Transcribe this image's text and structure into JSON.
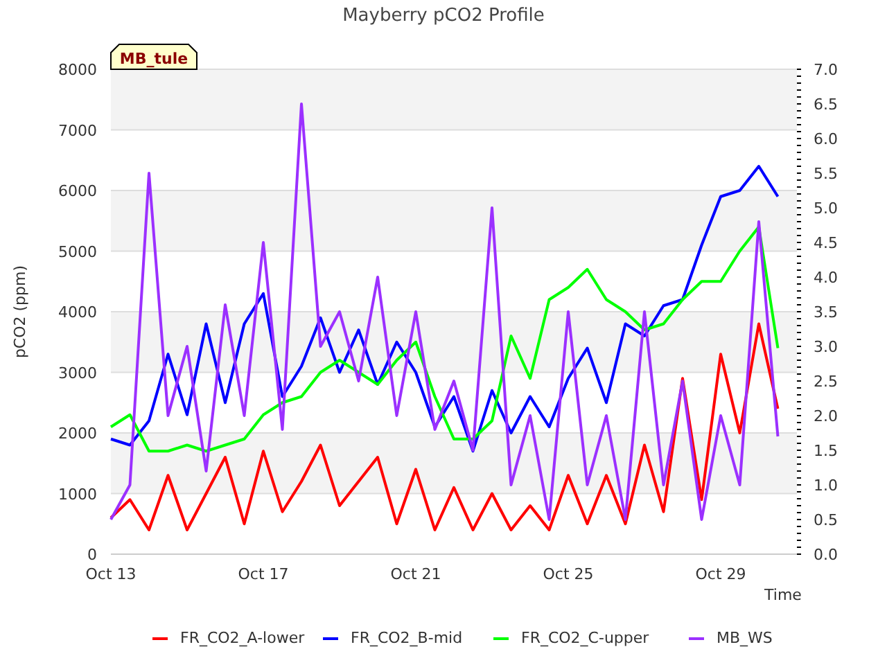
{
  "chart": {
    "site_label": "MB_tule",
    "chart_data": {
      "type": "line",
      "title": "Mayberry pCO2 Profile",
      "xlabel": "Time",
      "ylabel": "pCO2 (ppm)",
      "categories": [
        "Oct 13",
        null,
        null,
        null,
        null,
        null,
        null,
        null,
        "Oct 17",
        null,
        null,
        null,
        null,
        null,
        null,
        null,
        "Oct 21",
        null,
        null,
        null,
        null,
        null,
        null,
        null,
        "Oct 25",
        null,
        null,
        null,
        null,
        null,
        null,
        null,
        "Oct 29",
        null,
        null,
        null
      ],
      "ylim": [
        0,
        8000
      ],
      "grid": true,
      "legend": true,
      "yticks": [
        0,
        1000,
        2000,
        3000,
        4000,
        5000,
        6000,
        7000,
        8000
      ],
      "y2lim": [
        0,
        7
      ],
      "y2ticks": [
        {
          "value": 0,
          "label": "0.0"
        },
        {
          "value": 0.5,
          "label": "0.5"
        },
        {
          "value": 1,
          "label": "1.0"
        },
        {
          "value": 1.5,
          "label": "1.5"
        },
        {
          "value": 2,
          "label": "2.0"
        },
        {
          "value": 2.5,
          "label": "2.5"
        },
        {
          "value": 3,
          "label": "3.0"
        },
        {
          "value": 3.5,
          "label": "3.5"
        },
        {
          "value": 4,
          "label": "4.0"
        },
        {
          "value": 4.5,
          "label": "4.5"
        },
        {
          "value": 5,
          "label": "5.0"
        },
        {
          "value": 5.5,
          "label": "5.5"
        },
        {
          "value": 6,
          "label": "6.0"
        },
        {
          "value": 6.5,
          "label": "6.5"
        },
        {
          "value": 7,
          "label": "7.0"
        }
      ],
      "series": [
        {
          "name": "FR_CO2_A-lower",
          "color": "#ff0000",
          "axis": "y",
          "values": [
            600,
            900,
            400,
            1300,
            400,
            1000,
            1600,
            500,
            1700,
            700,
            1200,
            1800,
            800,
            1200,
            1600,
            500,
            1400,
            400,
            1100,
            400,
            1000,
            400,
            800,
            400,
            1300,
            500,
            1300,
            500,
            1800,
            700,
            2900,
            900,
            3300,
            2000,
            3800,
            2400
          ]
        },
        {
          "name": "FR_CO2_B-mid",
          "color": "#0000ff",
          "axis": "y",
          "values": [
            1900,
            1800,
            2200,
            3300,
            2300,
            3800,
            2500,
            3800,
            4300,
            2600,
            3100,
            3900,
            3000,
            3700,
            2800,
            3500,
            3000,
            2100,
            2600,
            1700,
            2700,
            2000,
            2600,
            2100,
            2900,
            3400,
            2500,
            3800,
            3600,
            4100,
            4200,
            5100,
            5900,
            6000,
            6400,
            5900
          ]
        },
        {
          "name": "FR_CO2_C-upper",
          "color": "#00ff00",
          "axis": "y",
          "values": [
            2100,
            2300,
            1700,
            1700,
            1800,
            1700,
            1800,
            1900,
            2300,
            2500,
            2600,
            3000,
            3200,
            3000,
            2800,
            3200,
            3500,
            2600,
            1900,
            1900,
            2200,
            3600,
            2900,
            4200,
            4400,
            4700,
            4200,
            4000,
            3700,
            3800,
            4200,
            4500,
            4500,
            5000,
            5400,
            3400
          ]
        },
        {
          "name": "MB_WS",
          "color": "#9b30ff",
          "axis": "y2",
          "values": [
            0.5,
            1.0,
            5.5,
            2.0,
            3.0,
            1.2,
            3.6,
            2.0,
            4.5,
            1.8,
            6.5,
            3.0,
            3.5,
            2.5,
            4.0,
            2.0,
            3.5,
            1.8,
            2.5,
            1.5,
            5.0,
            1.0,
            2.0,
            0.5,
            3.5,
            1.0,
            2.0,
            0.5,
            3.5,
            1.0,
            2.5,
            0.5,
            2.0,
            1.0,
            4.8,
            1.7
          ]
        }
      ]
    }
  }
}
